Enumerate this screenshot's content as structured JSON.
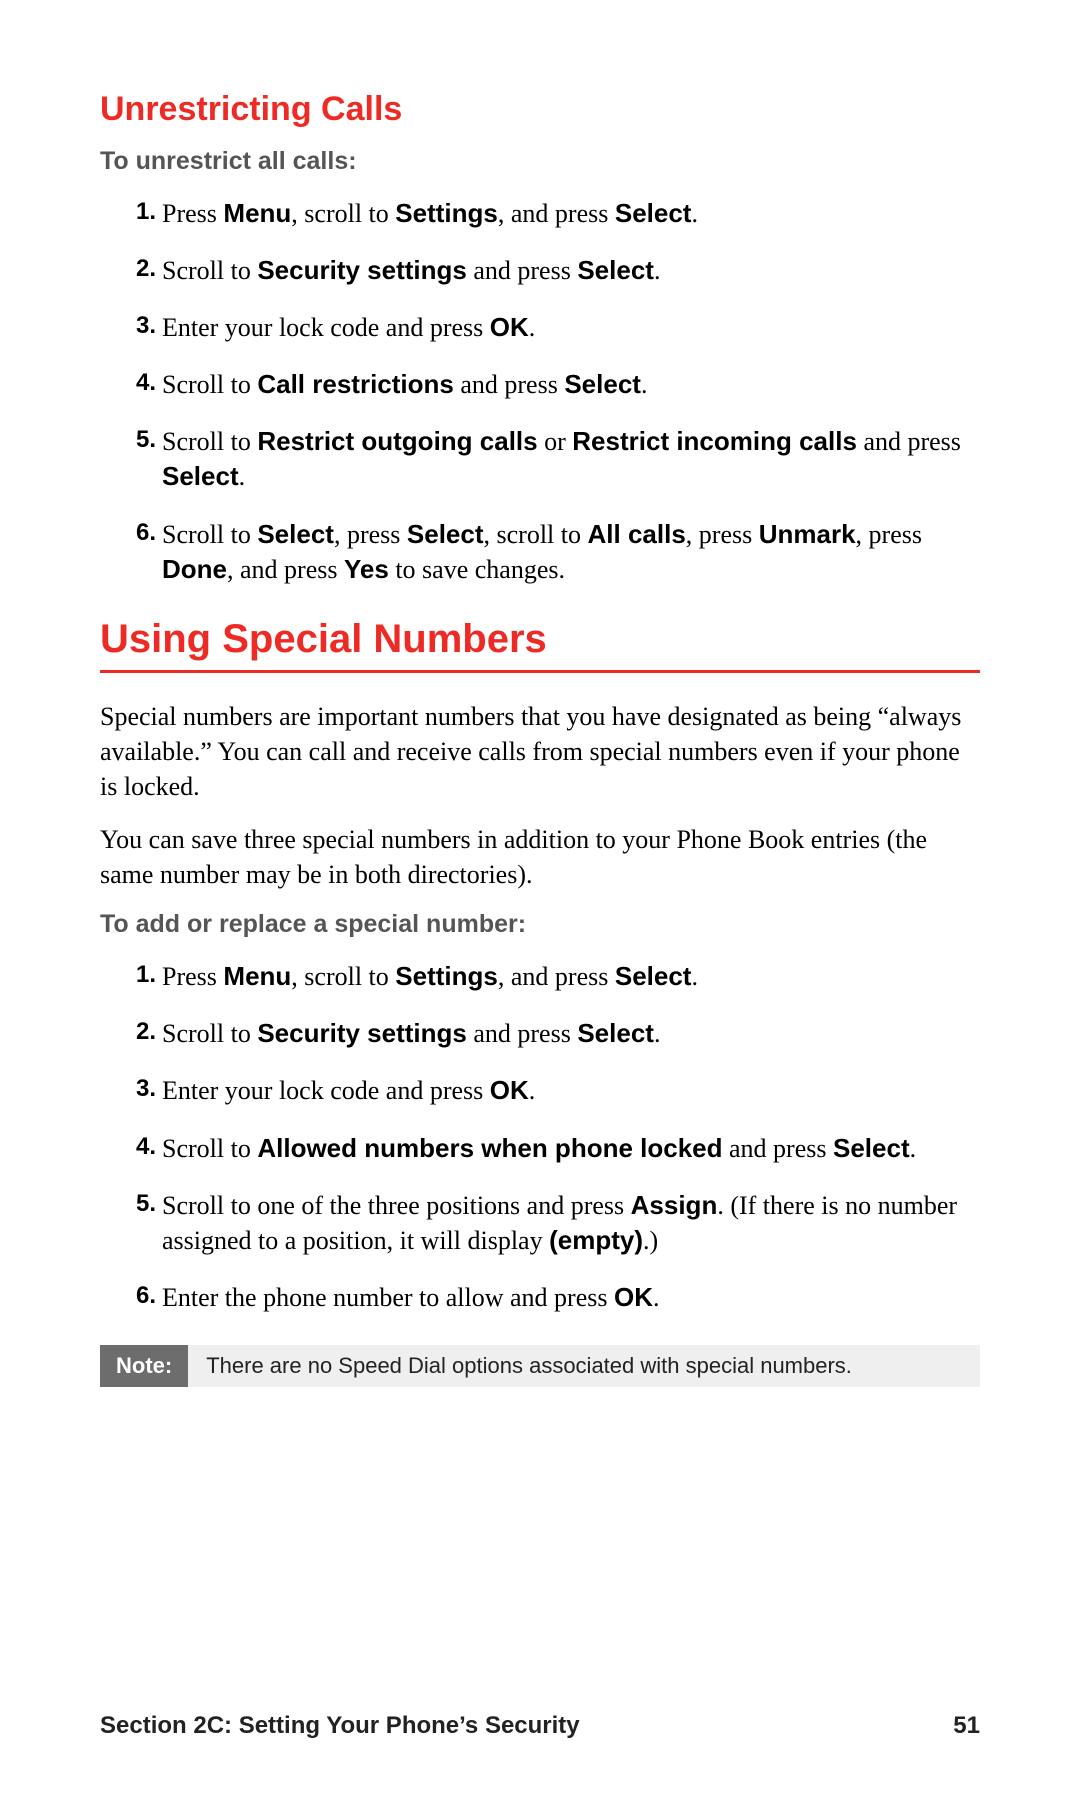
{
  "section1": {
    "heading": "Unrestricting Calls",
    "lead": "To unrestrict all calls:",
    "steps": [
      {
        "n": "1.",
        "parts": [
          "Press ",
          "Menu",
          ", scroll to ",
          "Settings",
          ", and press ",
          "Select",
          "."
        ]
      },
      {
        "n": "2.",
        "parts": [
          "Scroll to ",
          "Security settings",
          " and press ",
          "Select",
          "."
        ]
      },
      {
        "n": "3.",
        "parts": [
          "Enter your lock code and press ",
          "OK",
          "."
        ]
      },
      {
        "n": "4.",
        "parts": [
          "Scroll to ",
          "Call restrictions",
          " and press ",
          "Select",
          "."
        ]
      },
      {
        "n": "5.",
        "parts": [
          "Scroll to ",
          "Restrict outgoing calls",
          " or ",
          "Restrict incoming calls",
          " and press ",
          "Select",
          "."
        ]
      },
      {
        "n": "6.",
        "parts": [
          "Scroll to ",
          "Select",
          ", press ",
          "Select",
          ", scroll to ",
          "All calls",
          ", press ",
          "Unmark",
          ", press ",
          "Done",
          ", and press ",
          "Yes",
          " to save changes."
        ]
      }
    ]
  },
  "section2": {
    "heading": "Using Special Numbers",
    "para1": "Special numbers are important numbers that you have designated as being “always available.” You can call and receive calls from special numbers even if your phone is locked.",
    "para2": "You can save three special numbers in addition to your Phone Book entries (the same number may be in both directories).",
    "lead": "To add or replace a special number:",
    "steps": [
      {
        "n": "1.",
        "parts": [
          "Press ",
          "Menu",
          ", scroll to ",
          "Settings",
          ", and press ",
          "Select",
          "."
        ]
      },
      {
        "n": "2.",
        "parts": [
          "Scroll to ",
          "Security settings",
          " and press ",
          "Select",
          "."
        ]
      },
      {
        "n": "3.",
        "parts": [
          "Enter your lock code and press ",
          "OK",
          "."
        ]
      },
      {
        "n": "4.",
        "parts": [
          "Scroll to ",
          "Allowed numbers when phone locked",
          " and press ",
          "Select",
          "."
        ]
      },
      {
        "n": "5.",
        "parts": [
          "Scroll to one of the three positions and press ",
          "Assign",
          ". (If there is no number assigned to a position, it will display ",
          "(empty)",
          ".)"
        ]
      },
      {
        "n": "6.",
        "parts": [
          "Enter the phone number to allow and press ",
          "OK",
          "."
        ]
      }
    ]
  },
  "note": {
    "label": "Note:",
    "text": "There are no Speed Dial options associated with special numbers."
  },
  "footer": {
    "left": "Section 2C: Setting Your Phone’s Security",
    "right": "51"
  }
}
